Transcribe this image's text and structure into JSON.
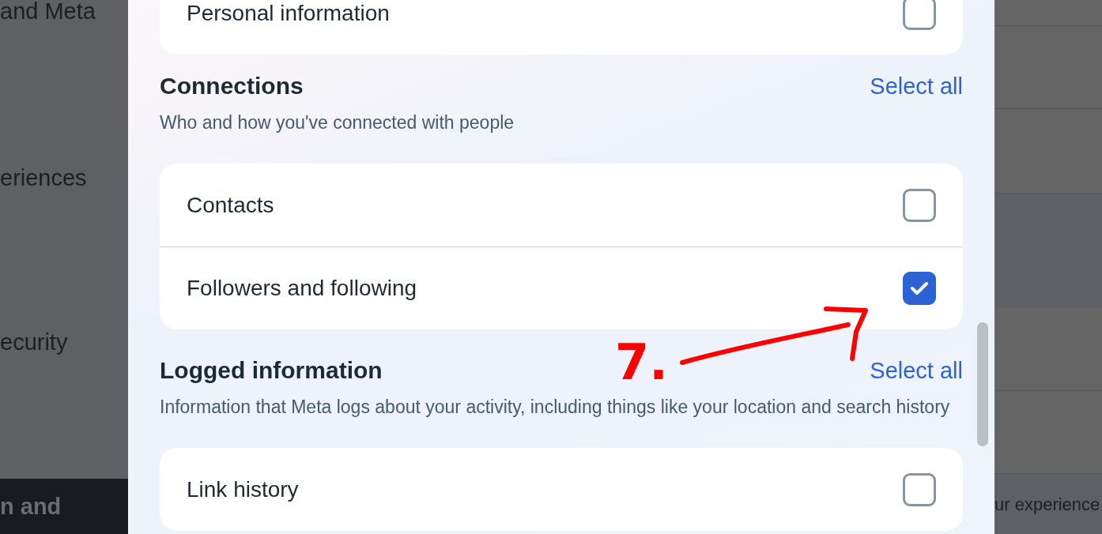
{
  "background": {
    "left_texts": [
      "and Meta",
      "eriences",
      "ecurity"
    ],
    "left_footer": "n and",
    "right_text": "ur experience"
  },
  "dialog": {
    "sections": [
      {
        "items": [
          {
            "label": "Personal information",
            "checked": false
          }
        ]
      },
      {
        "title": "Connections",
        "select_all": "Select all",
        "description": "Who and how you've connected with people",
        "items": [
          {
            "label": "Contacts",
            "checked": false
          },
          {
            "label": "Followers and following",
            "checked": true
          }
        ]
      },
      {
        "title": "Logged information",
        "select_all": "Select all",
        "description": "Information that Meta logs about your activity, including things like your location and search history",
        "items": [
          {
            "label": "Link history",
            "checked": false
          }
        ]
      }
    ]
  },
  "annotation": {
    "text": "7."
  }
}
